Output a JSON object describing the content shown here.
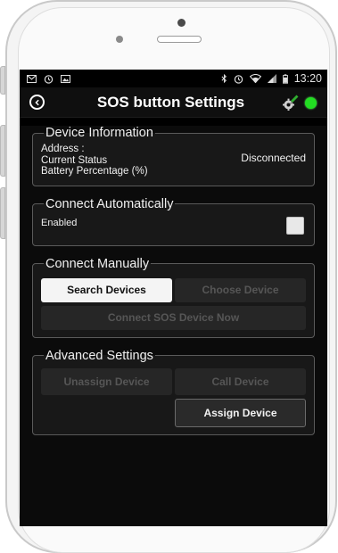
{
  "status_bar": {
    "time": "13:20",
    "left_icons": [
      "mail-icon",
      "alarm-icon",
      "image-icon"
    ],
    "right_icons": [
      "bluetooth-icon",
      "alarm-icon",
      "wifi-icon",
      "signal-icon",
      "battery-icon"
    ]
  },
  "app_bar": {
    "title": "SOS button Settings",
    "back_icon": "back-arrow-icon",
    "right_icons": [
      "settings-icon",
      "connection-status-indicator"
    ],
    "status_color": "#22dd22"
  },
  "device_information": {
    "legend": "Device Information",
    "address_label": "Address :",
    "status_label": "Current Status",
    "status_value": "Disconnected",
    "battery_label": "Battery Percentage (%)"
  },
  "connect_automatically": {
    "legend": "Connect Automatically",
    "enabled_label": "Enabled",
    "enabled": false
  },
  "connect_manually": {
    "legend": "Connect Manually",
    "search_button": "Search Devices",
    "choose_button": "Choose Device",
    "connect_button": "Connect SOS Device Now"
  },
  "advanced_settings": {
    "legend": "Advanced Settings",
    "unassign_button": "Unassign Device",
    "call_button": "Call Device",
    "assign_button": "Assign Device"
  }
}
